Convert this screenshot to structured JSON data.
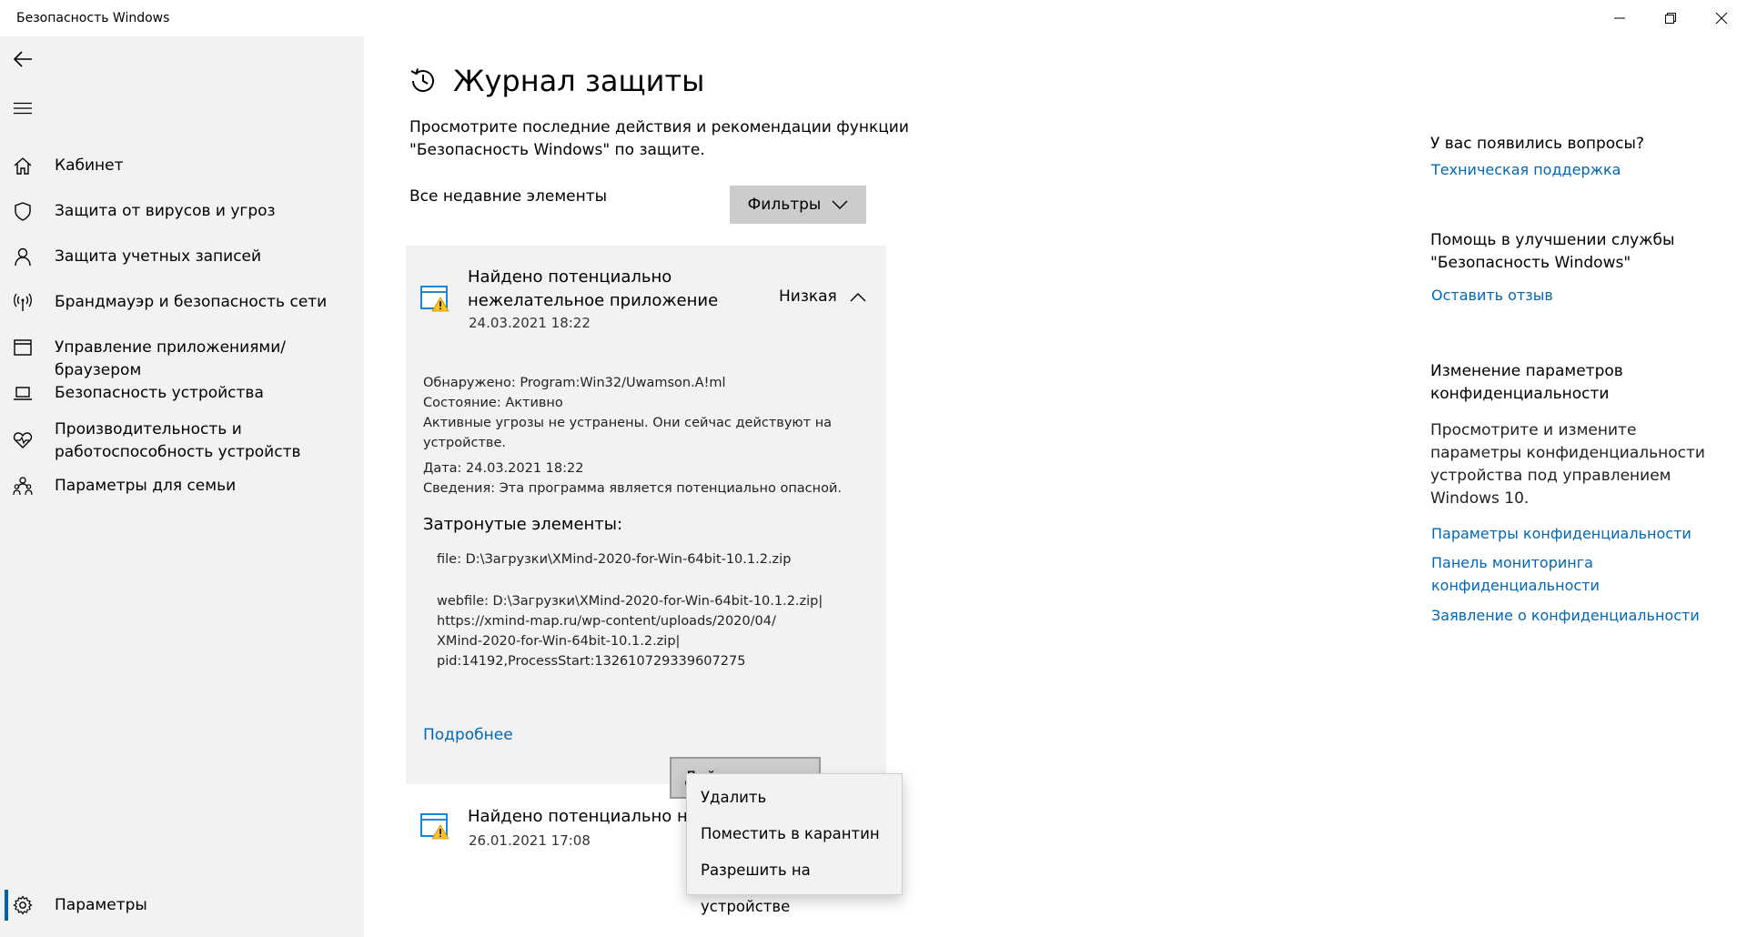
{
  "window": {
    "title": "Безопасность Windows"
  },
  "sidebar": {
    "items": [
      {
        "label": "Кабинет",
        "icon": "home-icon"
      },
      {
        "label": "Защита от вирусов и угроз",
        "icon": "shield-icon"
      },
      {
        "label": "Защита учетных записей",
        "icon": "person-icon"
      },
      {
        "label": "Брандмауэр и безопасность сети",
        "icon": "wifi-antenna-icon"
      },
      {
        "label": "Управление приложениями/браузером",
        "icon": "app-window-icon"
      },
      {
        "label": "Безопасность устройства",
        "icon": "laptop-icon"
      },
      {
        "label": "Производительность и\nработоспособность устройств",
        "icon": "heart-icon"
      },
      {
        "label": "Параметры для семьи",
        "icon": "family-icon"
      }
    ],
    "settings_label": "Параметры"
  },
  "main": {
    "title": "Журнал защиты",
    "description": "Просмотрите последние действия и рекомендации функции \"Безопасность Windows\" по защите.",
    "recent_label": "Все недавние элементы",
    "filters_label": "Фильтры",
    "threat": {
      "title": "Найдено потенциально нежелательное приложение",
      "date": "24.03.2021 18:22",
      "level": "Низкая",
      "detected": "Обнаружено: Program:Win32/Uwamson.A!ml",
      "status": "Состояние:  Активно",
      "active_note": "Активные угрозы не устранены. Они сейчас действуют на устройстве.",
      "date_line": "Дата: 24.03.2021 18:22",
      "details": "Сведения:  Эта программа является потенциально опасной.",
      "affected_heading": "Затронутые элементы:",
      "file_line": "file: D:\\Загрузки\\XMind-2020-for-Win-64bit-10.1.2.zip",
      "webfile_line": "webfile: D:\\Загрузки\\XMind-2020-for-Win-64bit-10.1.2.zip|\nhttps://xmind-map.ru/wp-content/uploads/2020/04/\nXMind-2020-for-Win-64bit-10.1.2.zip|\npid:14192,ProcessStart:132610729339607275",
      "more_link": "Подробнее",
      "actions_label": "Действия"
    },
    "threat2": {
      "title": "Найдено потенциально нежелательное приложение",
      "date": "26.01.2021 17:08"
    },
    "dropdown": {
      "items": [
        "Удалить",
        "Поместить в карантин",
        "Разрешить на устройстве"
      ]
    }
  },
  "right": {
    "questions_heading": "У вас появились вопросы?",
    "support_link": "Техническая поддержка",
    "improve_heading": "Помощь в улучшении службы\n\"Безопасность Windows\"",
    "feedback_link": "Оставить отзыв",
    "privacy_heading": "Изменение параметров\nконфиденциальности",
    "privacy_text": "Просмотрите и измените параметры конфиденциальности устройства под управлением Windows 10.",
    "privacy_links": [
      "Параметры конфиденциальности",
      "Панель мониторинга конфиденциальности",
      "Заявление о конфиденциальности"
    ]
  },
  "colors": {
    "accent": "#0067b8",
    "sidebar_bg": "#f2f2f2",
    "button_bg": "#cccccc"
  }
}
